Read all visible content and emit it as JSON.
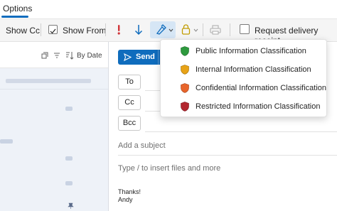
{
  "tabs": {
    "options_label": "Options"
  },
  "ribbon": {
    "show_cc": "Show Cc",
    "show_from": "Show From",
    "request_receipt": "Request delivery receipt",
    "colors": {
      "flag_red": "#d13438",
      "arrow_blue": "#0f6cbd",
      "lock_amber": "#c19c00"
    }
  },
  "list": {
    "sort_label": "By Date"
  },
  "compose": {
    "send_label": "Send",
    "to_label": "To",
    "cc_label": "Cc",
    "bcc_label": "Bcc",
    "subject_placeholder": "Add a subject",
    "body_placeholder": "Type / to insert files and more",
    "signature_line1": "Thanks!",
    "signature_line2": "Andy"
  },
  "dropdown": {
    "items": [
      {
        "label": "Public Information Classification",
        "icon": "green-shield-icon",
        "color": "#2e9a3e"
      },
      {
        "label": "Internal Information Classification",
        "icon": "yellow-shield-icon",
        "color": "#e8a317"
      },
      {
        "label": "Confidential Information Classification",
        "icon": "orange-shield-icon",
        "color": "#e8652b"
      },
      {
        "label": "Restricted Information Classification",
        "icon": "red-shield-icon",
        "color": "#b3262f"
      }
    ]
  }
}
